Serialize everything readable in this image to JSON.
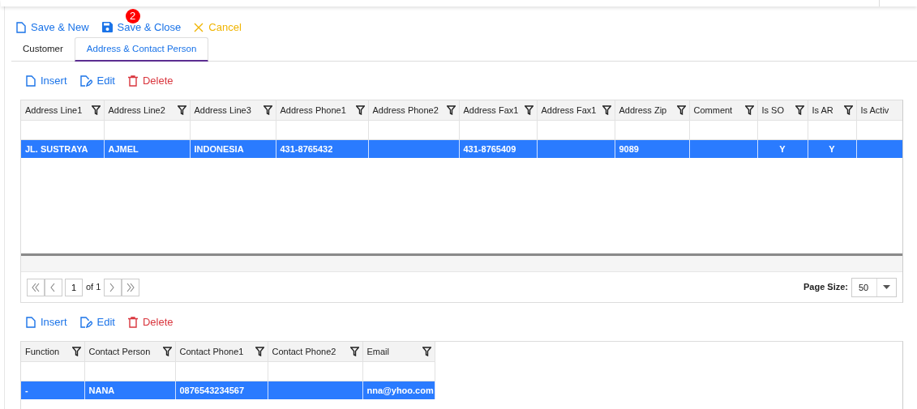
{
  "toolbar": [
    {
      "kind": "new",
      "label": "Save & New"
    },
    {
      "kind": "save",
      "label": "Save & Close",
      "badge": "2"
    },
    {
      "kind": "cancel",
      "label": "Cancel"
    }
  ],
  "tabs": [
    {
      "label": "Customer",
      "selected": false
    },
    {
      "label": "Address & Contact Person",
      "selected": true
    }
  ],
  "grids": [
    {
      "actions": [
        {
          "kind": "insert",
          "label": "Insert"
        },
        {
          "kind": "edit",
          "label": "Edit"
        },
        {
          "kind": "delete",
          "label": "Delete"
        }
      ],
      "columns": [
        "Address Line1",
        "Address Line2",
        "Address Line3",
        "Address Phone1",
        "Address Phone2",
        "Address Fax1",
        "Address Fax1",
        "Address Zip",
        "Comment",
        "Is SO",
        "Is AR",
        "Is Activ"
      ],
      "rows": [
        {
          "selected": true,
          "cells": [
            "JL. SUSTRAYA",
            "AJMEL",
            "INDONESIA",
            "431-8765432",
            null,
            "431-8765409",
            null,
            "9089",
            null,
            "Y",
            "Y",
            null
          ]
        }
      ],
      "pager": {
        "page": "1",
        "of": "of 1",
        "page_size_label": "Page Size:",
        "page_size": "50"
      }
    },
    {
      "actions": [
        {
          "kind": "insert",
          "label": "Insert"
        },
        {
          "kind": "edit",
          "label": "Edit"
        },
        {
          "kind": "delete",
          "label": "Delete"
        }
      ],
      "columns": [
        "Function",
        "Contact Person",
        "Contact Phone1",
        "Contact Phone2",
        "Email"
      ],
      "rows": [
        {
          "selected": true,
          "cells": [
            "-",
            "NANA",
            "0876543234567",
            null,
            "nna@yhoo.com"
          ]
        }
      ]
    }
  ]
}
